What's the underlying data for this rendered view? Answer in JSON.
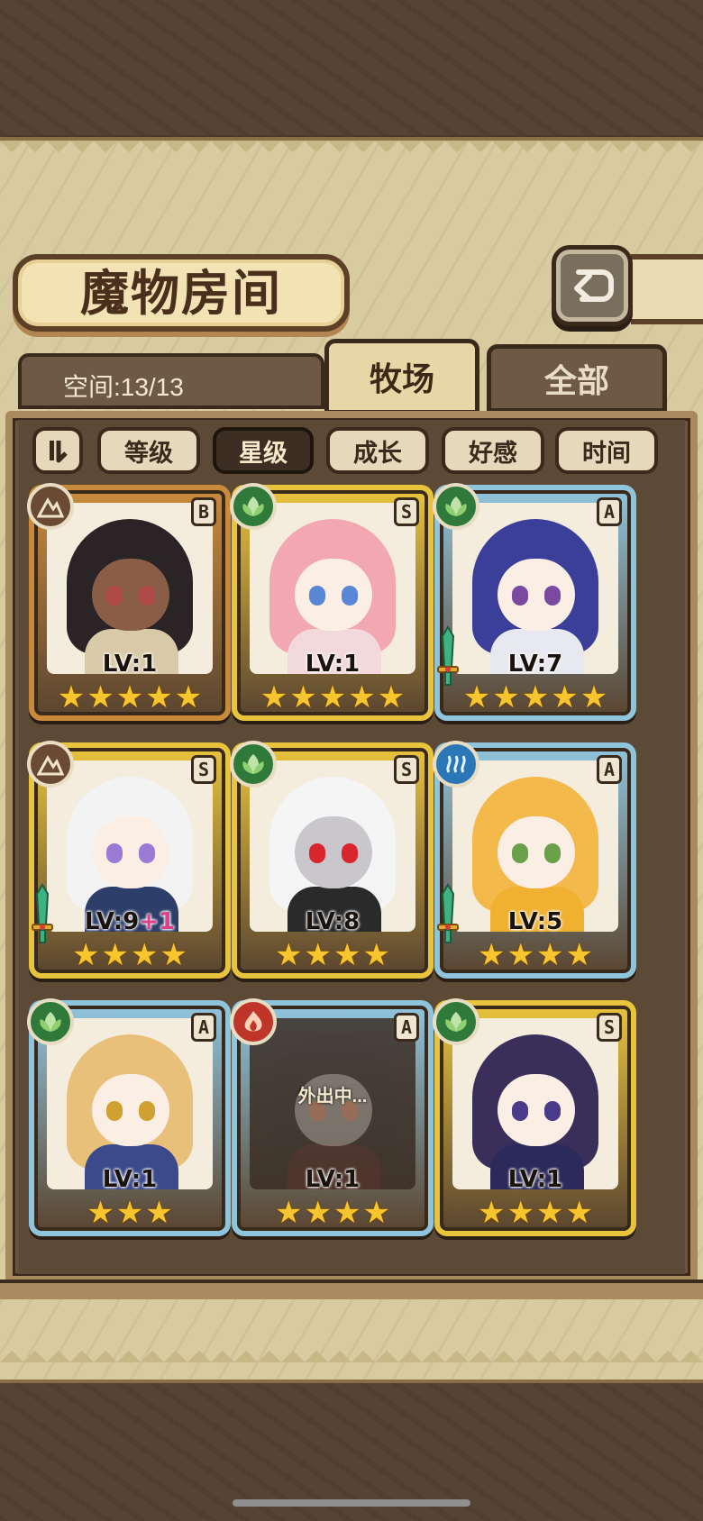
{
  "header": {
    "title": "魔物房间",
    "back_icon": "return-arrow-icon"
  },
  "space": {
    "label": "空间:13/13"
  },
  "tabs": [
    {
      "label": "牧场",
      "active": true
    },
    {
      "label": "全部",
      "active": false
    }
  ],
  "sort": {
    "toggle_icon": "sort-order-icon",
    "options": [
      {
        "label": "等级",
        "active": false
      },
      {
        "label": "星级",
        "active": true
      },
      {
        "label": "成长",
        "active": false
      },
      {
        "label": "好感",
        "active": false
      },
      {
        "label": "时间",
        "active": false
      }
    ]
  },
  "colors": {
    "gold": "#e8c33c",
    "blue": "#8fc4dd",
    "bronze": "#c98a3c",
    "fire": "#c0352a",
    "plant": "#2f7a3a",
    "earth": "#6b4a34",
    "water": "#2a77b8"
  },
  "monsters": [
    {
      "element": "earth",
      "element_icon": "mountain-icon",
      "rank": "B",
      "level": "LV:1",
      "stars": 5,
      "frame": "bronze",
      "weapon": false,
      "away": "",
      "bonus": ""
    },
    {
      "element": "plant",
      "element_icon": "leaf-icon",
      "rank": "S",
      "level": "LV:1",
      "stars": 5,
      "frame": "gold",
      "weapon": false,
      "away": "",
      "bonus": ""
    },
    {
      "element": "plant",
      "element_icon": "leaf-icon",
      "rank": "A",
      "level": "LV:7",
      "stars": 5,
      "frame": "blue",
      "weapon": true,
      "away": "",
      "bonus": ""
    },
    {
      "element": "earth",
      "element_icon": "mountain-icon",
      "rank": "S",
      "level": "LV:9",
      "stars": 4,
      "frame": "gold",
      "weapon": true,
      "away": "",
      "bonus": "+1"
    },
    {
      "element": "plant",
      "element_icon": "leaf-icon",
      "rank": "S",
      "level": "LV:8",
      "stars": 4,
      "frame": "gold",
      "weapon": false,
      "away": "",
      "bonus": ""
    },
    {
      "element": "water",
      "element_icon": "water-wave-icon",
      "rank": "A",
      "level": "LV:5",
      "stars": 4,
      "frame": "blue",
      "weapon": true,
      "away": "",
      "bonus": ""
    },
    {
      "element": "plant",
      "element_icon": "leaf-icon",
      "rank": "A",
      "level": "LV:1",
      "stars": 3,
      "frame": "blue",
      "weapon": false,
      "away": "",
      "bonus": ""
    },
    {
      "element": "fire",
      "element_icon": "flame-icon",
      "rank": "A",
      "level": "LV:1",
      "stars": 4,
      "frame": "blue",
      "weapon": false,
      "away": "外出中...",
      "bonus": ""
    },
    {
      "element": "plant",
      "element_icon": "leaf-icon",
      "rank": "S",
      "level": "LV:1",
      "stars": 4,
      "frame": "gold",
      "weapon": false,
      "away": "",
      "bonus": ""
    }
  ]
}
